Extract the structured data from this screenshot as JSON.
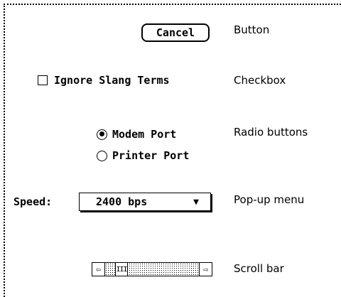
{
  "button": {
    "label": "Cancel",
    "caption": "Button"
  },
  "checkbox": {
    "label": "Ignore Slang Terms",
    "checked": false,
    "caption": "Checkbox"
  },
  "radio_buttons": {
    "options": [
      {
        "label": "Modem Port",
        "selected": true
      },
      {
        "label": "Printer Port",
        "selected": false
      }
    ],
    "caption": "Radio buttons"
  },
  "popup_menu": {
    "label": "Speed:",
    "value": "2400 bps",
    "arrow": "▼",
    "caption": "Pop-up menu"
  },
  "scroll_bar": {
    "left_arrow": "⇦",
    "right_arrow": "⇨",
    "thumb_grip": "III",
    "caption": "Scroll bar"
  }
}
